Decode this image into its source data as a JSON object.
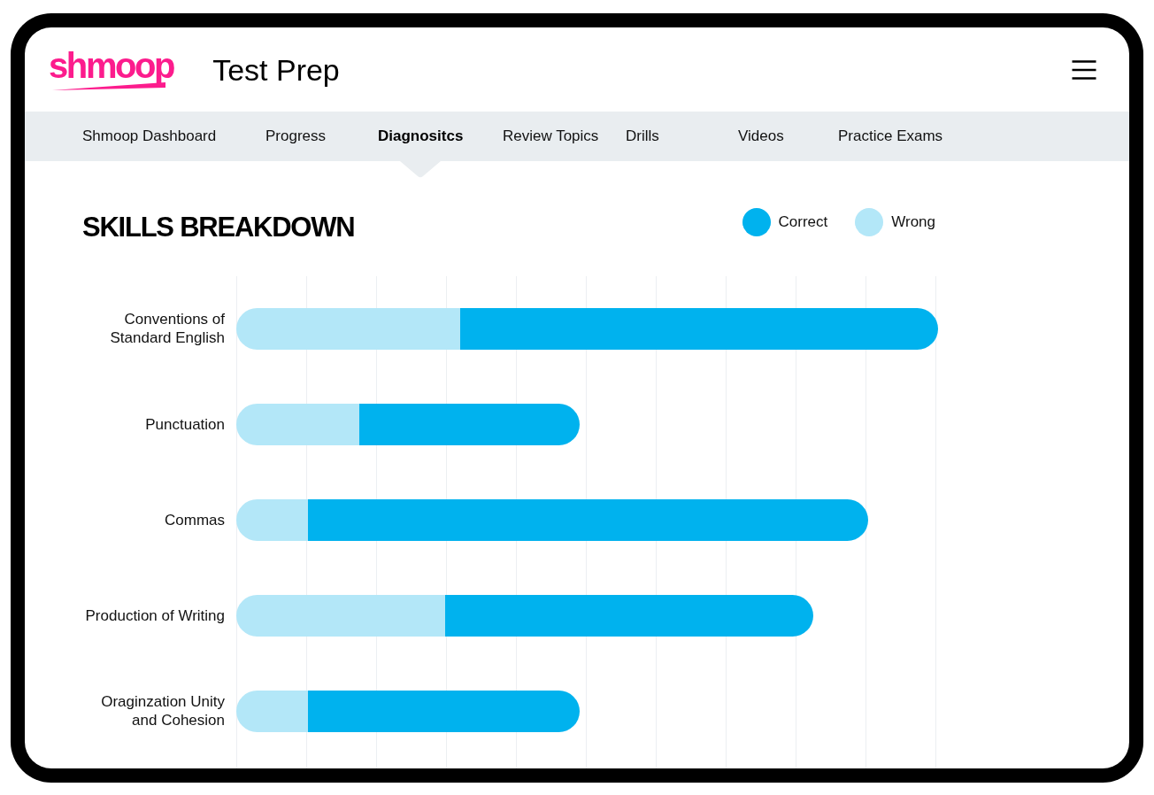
{
  "header": {
    "logo": "shmoop",
    "title": "Test Prep"
  },
  "nav": {
    "tabs": [
      {
        "label": "Shmoop Dashboard",
        "selected": false
      },
      {
        "label": "Progress",
        "selected": false
      },
      {
        "label": "Diagnositcs",
        "selected": true
      },
      {
        "label": "Review Topics",
        "selected": false
      },
      {
        "label": "Drills",
        "selected": false
      },
      {
        "label": "Videos",
        "selected": false
      },
      {
        "label": "Practice Exams",
        "selected": false
      }
    ]
  },
  "skills_breakdown": {
    "title": "SKILLS BREAKDOWN",
    "legend": [
      {
        "label": "Correct",
        "color": "#00b2ee"
      },
      {
        "label": "Wrong",
        "color": "#b3e7f8"
      }
    ],
    "skills": [
      {
        "label": "Conventions of Standard English"
      },
      {
        "label": "Punctuation"
      },
      {
        "label": "Commas"
      },
      {
        "label": "Production of Writing"
      },
      {
        "label": "Oraginzation Unity and Cohesion"
      }
    ]
  }
}
